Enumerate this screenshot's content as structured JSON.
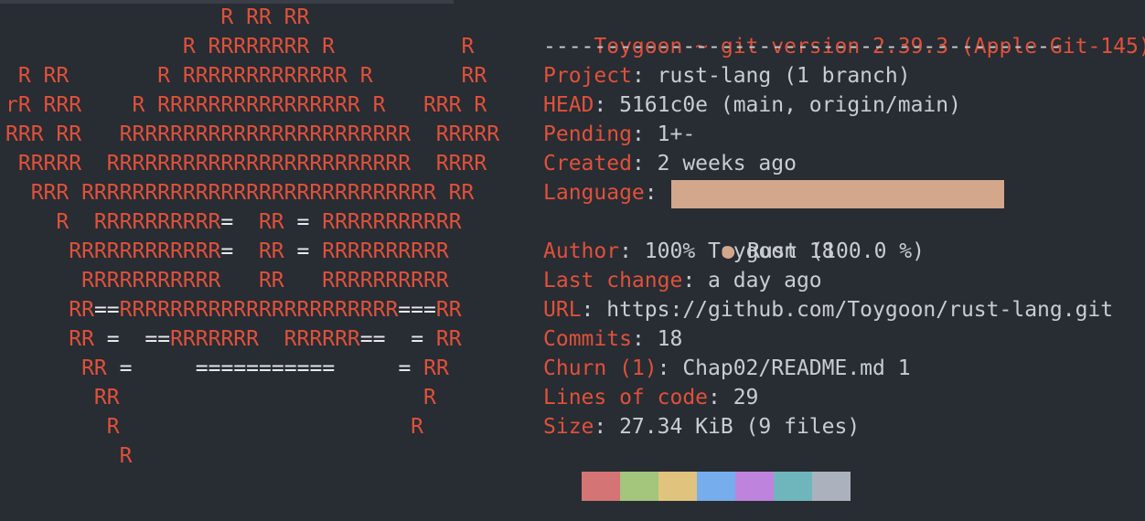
{
  "colors": {
    "background": "#282c33",
    "accent": "#e0513a",
    "text": "#c9cdd3",
    "rust_language": "#d2a78b"
  },
  "ascii_art": [
    "                 R RR RR",
    "              R RRRRRRRR R          R",
    " R RR       R RRRRRRRRRRRRR R       RR",
    "rR RRR    R RRRRRRRRRRRRRRRR R   RRR R",
    "RRR RR   RRRRRRRRRRRRRRRRRRRRRRR  RRRRR",
    " RRRRR  RRRRRRRRRRRRRRRRRRRRRRRR  RRRR",
    "  RRR RRRRRRRRRRRRRRRRRRRRRRRRRRRR RR",
    "    R  RRRRRRRRRR=  RR = RRRRRRRRRRR",
    "     RRRRRRRRRRRR=  RR = RRRRRRRRRR",
    "      RRRRRRRRRRR   RR   RRRRRRRRRR",
    "     RR==RRRRRRRRRRRRRRRRRRRRRR===RR",
    "     RR =  ==RRRRRRR  RRRRRR==  = RR",
    "      RR =     ===========     = RR",
    "       RR                        R",
    "        R                       R",
    "         R"
  ],
  "info": {
    "title_user": "Toygoon",
    "title_rest": " ~ git version 2.39.3 (Apple Git-145)",
    "separator": "-----------------------------------------",
    "rows": [
      {
        "key": "Project",
        "value": ": rust-lang (1 branch)"
      },
      {
        "key": "HEAD",
        "value": ": 5161c0e (main, origin/main)"
      },
      {
        "key": "Pending",
        "value": ": 1+-"
      },
      {
        "key": "Created",
        "value": ": 2 weeks ago"
      },
      {
        "key": "Language",
        "value": ": "
      },
      {
        "key": "",
        "value": ""
      },
      {
        "key": "Author",
        "value": ": 100% Toygoon 18"
      },
      {
        "key": "Last change",
        "value": ": a day ago"
      },
      {
        "key": "URL",
        "value": ": https://github.com/Toygoon/rust-lang.git"
      },
      {
        "key": "Commits",
        "value": ": 18"
      },
      {
        "key": "Churn (1)",
        "value": ": Chap02/README.md 1"
      },
      {
        "key": "Lines of code",
        "value": ": 29"
      },
      {
        "key": "Size",
        "value": ": 27.34 KiB (9 files)"
      }
    ],
    "language_legend": {
      "bullet": "●",
      "text": " Rust (100.0 %)",
      "share_percent": 100.0
    }
  },
  "palette": [
    "#d47474",
    "#a3c57c",
    "#e0c47e",
    "#76adec",
    "#be83dc",
    "#6fb6bc",
    "#abb2bd"
  ]
}
